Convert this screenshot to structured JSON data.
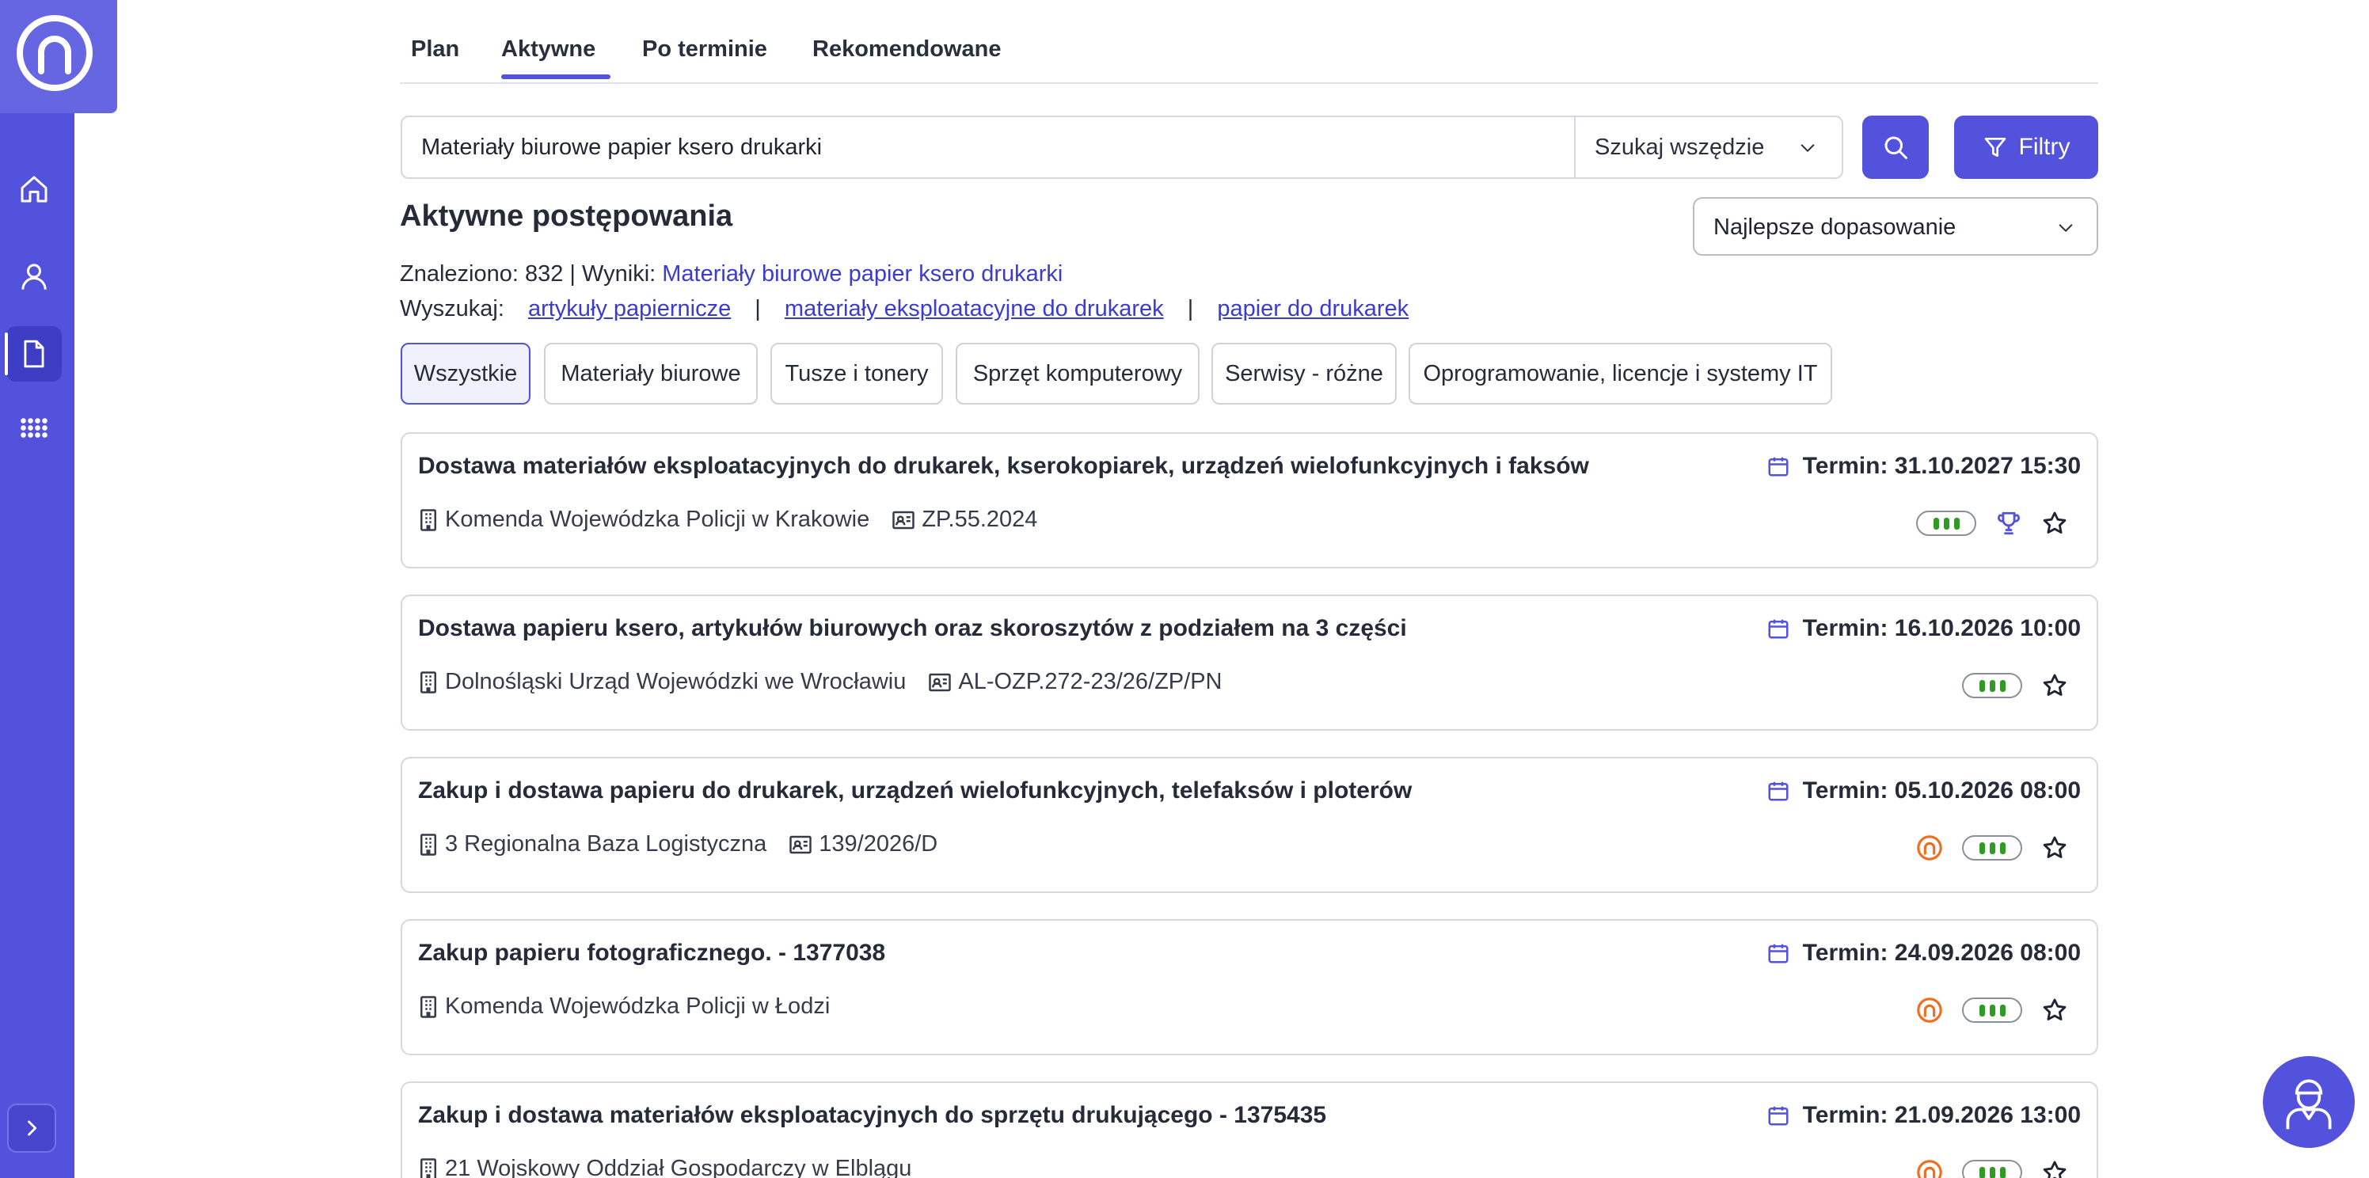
{
  "sidebar": {
    "logo_icon": "n-logo-icon",
    "items": [
      {
        "name": "home-icon"
      },
      {
        "name": "user-icon"
      },
      {
        "name": "document-icon",
        "active": true
      },
      {
        "name": "apps-grid-icon"
      }
    ],
    "expand_icon": "chevron-right-icon"
  },
  "tabs": [
    {
      "label": "Plan"
    },
    {
      "label": "Aktywne",
      "active": true
    },
    {
      "label": "Po terminie"
    },
    {
      "label": "Rekomendowane"
    }
  ],
  "search": {
    "value": "Materiały biurowe papier ksero drukarki",
    "scope": "Szukaj wszędzie",
    "filters_label": "Filtry"
  },
  "results": {
    "title": "Aktywne postępowania",
    "sort_label": "Najlepsze dopasowanie",
    "found_prefix": "Znaleziono: 832 | Wyniki: ",
    "found_query": "Materiały biurowe papier ksero drukarki",
    "suggest_label": "Wyszukaj:",
    "suggestions": [
      "artykuły papiernicze",
      "materiały eksploatacyjne do drukarek",
      "papier do drukarek"
    ],
    "suggest_separator": "|"
  },
  "categories": [
    {
      "label": "Wszystkie",
      "active": true
    },
    {
      "label": "Materiały biurowe"
    },
    {
      "label": "Tusze i tonery"
    },
    {
      "label": "Sprzęt komputerowy"
    },
    {
      "label": "Serwisy - różne"
    },
    {
      "label": "Oprogramowanie, licencje i systemy IT"
    }
  ],
  "tenders": [
    {
      "title": "Dostawa materiałów eksploatacyjnych do drukarek, kserokopiarek, urządzeń wielofunkcyjnych i faksów",
      "deadline": "Termin: 31.10.2027 15:30",
      "org": "Komenda Wojewódzka Policji w Krakowie",
      "ref": "ZP.55.2024",
      "trophy": true,
      "n_badge": false
    },
    {
      "title": "Dostawa papieru ksero, artykułów biurowych oraz skoroszytów z podziałem na 3 części",
      "deadline": "Termin: 16.10.2026 10:00",
      "org": "Dolnośląski Urząd Wojewódzki we Wrocławiu",
      "ref": "AL-OZP.272-23/26/ZP/PN",
      "trophy": false,
      "n_badge": false
    },
    {
      "title": "Zakup i dostawa papieru do drukarek, urządzeń wielofunkcyjnych, telefaksów i ploterów",
      "deadline": "Termin: 05.10.2026 08:00",
      "org": "3 Regionalna Baza Logistyczna",
      "ref": "139/2026/D",
      "trophy": false,
      "n_badge": true
    },
    {
      "title": "Zakup papieru fotograficznego. - 1377038",
      "deadline": "Termin: 24.09.2026 08:00",
      "org": "Komenda Wojewódzka Policji w Łodzi",
      "ref": "",
      "trophy": false,
      "n_badge": true
    },
    {
      "title": "Zakup i dostawa materiałów eksploatacyjnych do sprzętu drukującego - 1375435",
      "deadline": "Termin: 21.09.2026 13:00",
      "org": "21 Wojskowy Oddział Gospodarczy w Elblągu",
      "ref": "",
      "trophy": false,
      "n_badge": true
    }
  ],
  "colors": {
    "primary": "#5252dd",
    "match_green": "#2f9b25",
    "orange": "#f06d1f"
  },
  "assistant_icon": "assistant-avatar-icon"
}
